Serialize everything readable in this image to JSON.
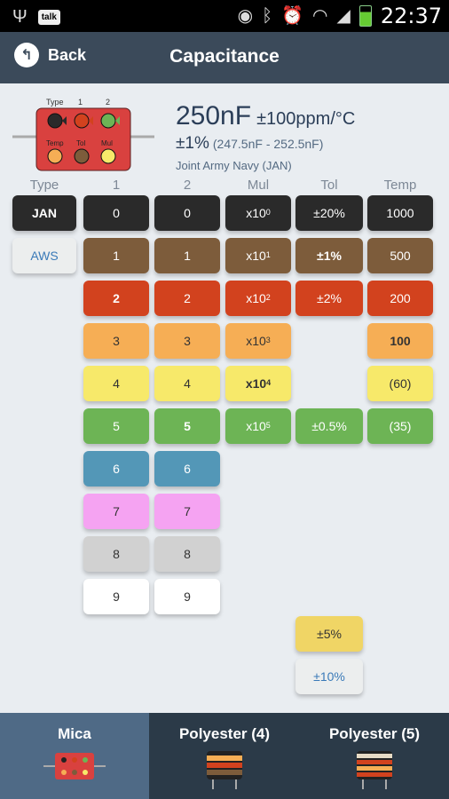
{
  "status_bar": {
    "time": "22:37",
    "talk_label": "talk",
    "left_icons": [
      "usb-icon",
      "talk-icon"
    ],
    "right_icons": [
      "eye-icon",
      "bluetooth-icon",
      "alarm-icon",
      "wifi-icon",
      "signal-icon",
      "battery-icon"
    ]
  },
  "header": {
    "back_label": "Back",
    "title": "Capacitance"
  },
  "diagram": {
    "labels": {
      "type": "Type",
      "one": "1",
      "two": "2",
      "temp": "Temp",
      "tol": "Tol",
      "mul": "Mul"
    }
  },
  "summary": {
    "value": "250nF",
    "tempco": "±100ppm/°C",
    "tolerance": "±1%",
    "range": "(247.5nF - 252.5nF)",
    "standard": "Joint Army Navy (JAN)"
  },
  "columns": [
    "Type",
    "1",
    "2",
    "Mul",
    "Tol",
    "Temp"
  ],
  "colors": {
    "black": "#2a2a2a",
    "brown": "#7d5c3b",
    "red": "#d2421e",
    "orange": "#f6ae55",
    "yellow": "#f7e96a",
    "green": "#6db455",
    "blue": "#5397b7",
    "violet": "#f5a3f2",
    "grey": "#d1d1d1",
    "white": "#ffffff",
    "gold": "#f0d565",
    "silver": "#eceeee",
    "header_bg": "#3b4a5a",
    "nav_bg": "#2b3a48",
    "nav_active": "#4f6a86",
    "page_bg": "#e9edf1"
  },
  "type_col": [
    {
      "label": "JAN",
      "color": "black",
      "selected": true
    },
    {
      "label": "AWS",
      "color": "silver",
      "selected": false
    }
  ],
  "digit1_col": [
    {
      "label": "0",
      "color": "black"
    },
    {
      "label": "1",
      "color": "brown"
    },
    {
      "label": "2",
      "color": "red",
      "selected": true
    },
    {
      "label": "3",
      "color": "orange"
    },
    {
      "label": "4",
      "color": "yellow"
    },
    {
      "label": "5",
      "color": "green"
    },
    {
      "label": "6",
      "color": "blue"
    },
    {
      "label": "7",
      "color": "violet"
    },
    {
      "label": "8",
      "color": "grey"
    },
    {
      "label": "9",
      "color": "white"
    }
  ],
  "digit2_col": [
    {
      "label": "0",
      "color": "black"
    },
    {
      "label": "1",
      "color": "brown"
    },
    {
      "label": "2",
      "color": "red"
    },
    {
      "label": "3",
      "color": "orange"
    },
    {
      "label": "4",
      "color": "yellow"
    },
    {
      "label": "5",
      "color": "green",
      "selected": true
    },
    {
      "label": "6",
      "color": "blue"
    },
    {
      "label": "7",
      "color": "violet"
    },
    {
      "label": "8",
      "color": "grey"
    },
    {
      "label": "9",
      "color": "white"
    }
  ],
  "mul_col": [
    {
      "base": "x10",
      "exp": "0",
      "color": "black"
    },
    {
      "base": "x10",
      "exp": "1",
      "color": "brown"
    },
    {
      "base": "x10",
      "exp": "2",
      "color": "red"
    },
    {
      "base": "x10",
      "exp": "3",
      "color": "orange"
    },
    {
      "base": "x10",
      "exp": "4",
      "color": "yellow",
      "selected": true
    },
    {
      "base": "x10",
      "exp": "5",
      "color": "green"
    }
  ],
  "tol_col": [
    {
      "label": "±20%",
      "color": "black",
      "row": 0
    },
    {
      "label": "±1%",
      "color": "brown",
      "row": 1,
      "selected": true
    },
    {
      "label": "±2%",
      "color": "red",
      "row": 2
    },
    {
      "label": "±0.5%",
      "color": "green",
      "row": 5
    },
    {
      "label": "±5%",
      "color": "gold",
      "row": "extra1"
    },
    {
      "label": "±10%",
      "color": "silver",
      "row": "extra2"
    }
  ],
  "temp_col": [
    {
      "label": "1000",
      "color": "black"
    },
    {
      "label": "500",
      "color": "brown"
    },
    {
      "label": "200",
      "color": "red"
    },
    {
      "label": "100",
      "color": "orange",
      "selected": true
    },
    {
      "label": "(60)",
      "color": "yellow"
    },
    {
      "label": "(35)",
      "color": "green"
    }
  ],
  "nav": {
    "tabs": [
      {
        "label": "Mica",
        "active": true
      },
      {
        "label": "Polyester (4)",
        "active": false
      },
      {
        "label": "Polyester (5)",
        "active": false
      }
    ]
  }
}
